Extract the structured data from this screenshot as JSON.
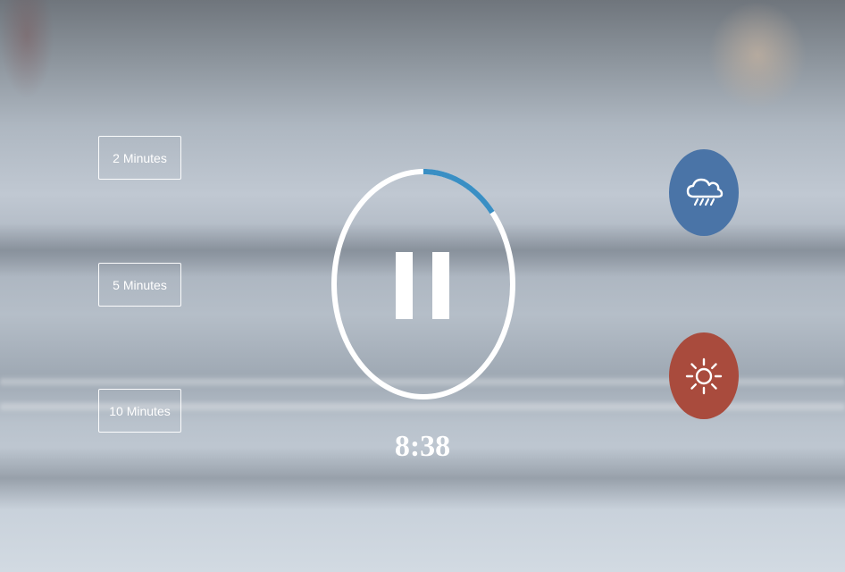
{
  "durations": [
    {
      "label": "2 Minutes"
    },
    {
      "label": "5 Minutes"
    },
    {
      "label": "10 Minutes"
    }
  ],
  "timer": {
    "display": "8:38",
    "progress": 0.14,
    "state": "playing",
    "control_icon": "pause-icon"
  },
  "sounds": [
    {
      "icon": "rain-cloud-icon",
      "color": "#4a74a7"
    },
    {
      "icon": "sun-icon",
      "color": "#a94b3d"
    }
  ],
  "colors": {
    "progress_arc": "#3a8fc4",
    "ring": "#ffffff"
  }
}
